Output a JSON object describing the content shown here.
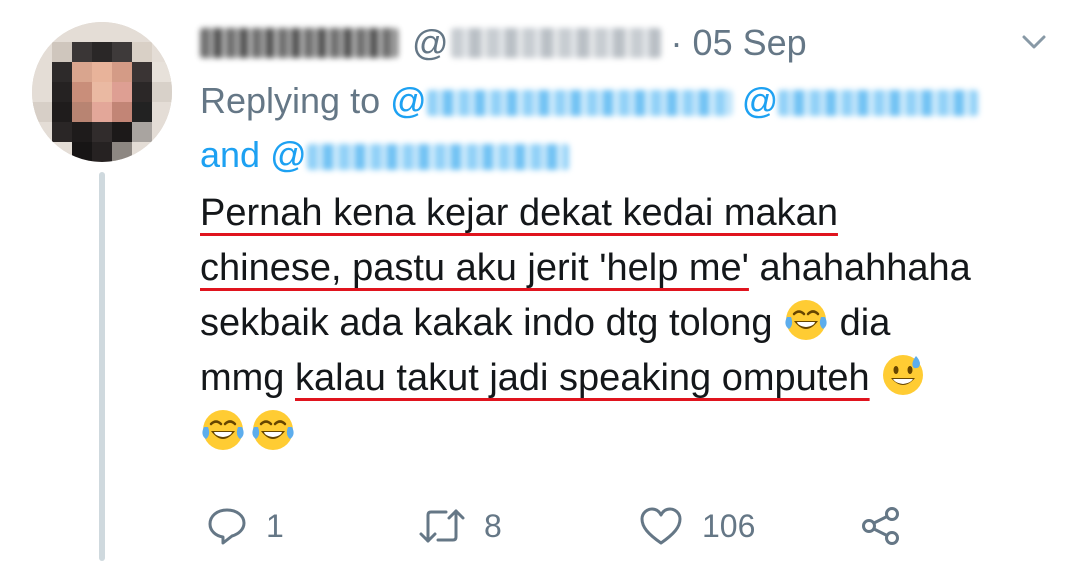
{
  "tweet": {
    "date": "05 Sep",
    "handle_prefix": "@",
    "separator": "·",
    "replying_prefix": "Replying to",
    "replying_and": "and",
    "mention_at": "@",
    "body": {
      "line1": "Pernah kena kejar dekat kedai makan",
      "line2_underlined": "chinese, pastu aku jerit 'help me'",
      "line2_rest": " ahahahhaha",
      "line3": "sekbaik ada kakak indo dtg tolong ",
      "line3_end": " dia",
      "line4_start": "mmg ",
      "line4_underlined": "kalau takut jadi speaking omputeh",
      "emoji_laugh": "face-with-tears-of-joy",
      "emoji_sweat": "grinning-face-with-sweat"
    },
    "actions": {
      "reply_count": "1",
      "retweet_count": "8",
      "like_count": "106"
    }
  },
  "colors": {
    "link": "#1da1f2",
    "meta": "#657786",
    "text": "#14171a",
    "underline": "#e0141e"
  }
}
